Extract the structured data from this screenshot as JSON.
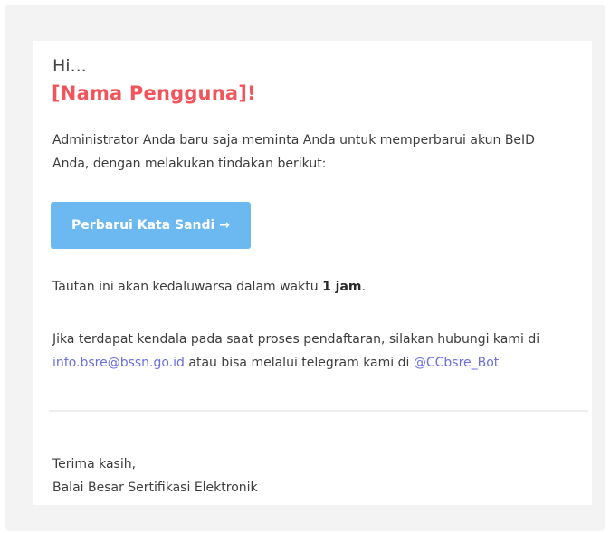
{
  "email": {
    "greeting": "Hi...",
    "name_placeholder": "[Nama Pengguna]!",
    "intro": "Administrator Anda baru saja meminta Anda untuk memperbarui akun BeID Anda, dengan melakukan tindakan berikut:",
    "button_label": "Perbarui Kata Sandi →",
    "expire_prefix": "Tautan ini akan kedaluwarsa dalam waktu ",
    "expire_time": "1 jam",
    "expire_suffix": ".",
    "help_prefix": "Jika terdapat kendala pada saat proses pendaftaran, silakan hubungi kami di",
    "help_email": "info.bsre@bssn.go.id",
    "help_middle": " atau bisa melalui telegram kami di ",
    "help_telegram": "@CCbsre_Bot",
    "signoff_line1": "Terima kasih,",
    "signoff_line2": "Balai Besar Sertifikasi Elektronik"
  },
  "colors": {
    "name_red": "#f2545b",
    "button_blue": "#6cb8f0",
    "link_purple": "#6b6fe0",
    "background": "#f3f3f3"
  }
}
